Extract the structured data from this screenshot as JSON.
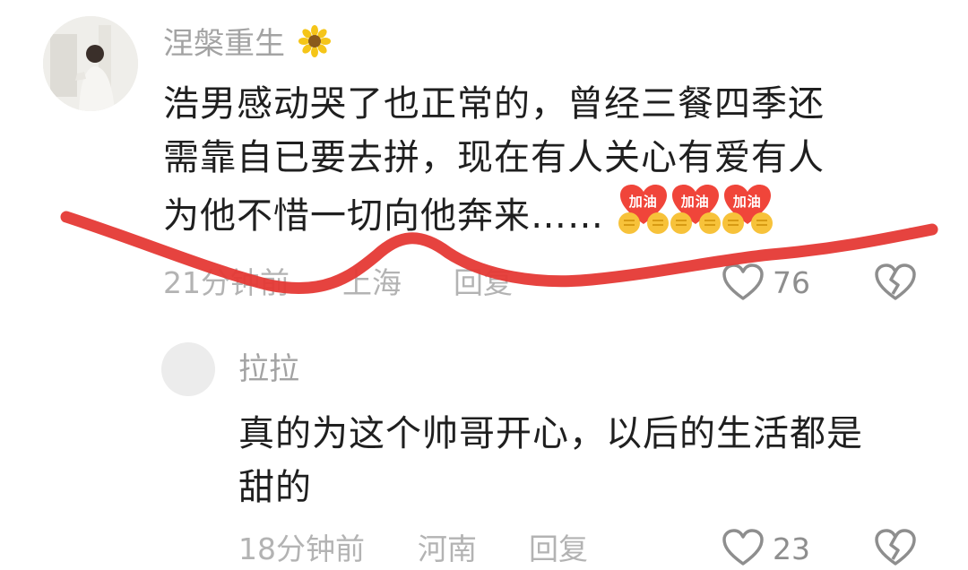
{
  "comment": {
    "username": "涅槃重生",
    "username_emoji_icon": "sunflower-icon",
    "text_lines": [
      "浩男感动哭了也正常的，曾经三餐四季还",
      "需靠自已要去拼，现在有人关心有爱有人",
      "为他不惜一切向他奔来……"
    ],
    "emoji_label": "加油",
    "time": "21分钟前",
    "location": "上海",
    "reply_label": "回复",
    "like_count": "76",
    "like_icon": "heart-outline-icon",
    "dislike_icon": "broken-heart-icon"
  },
  "reply": {
    "username": "拉拉",
    "text_lines": [
      "真的为这个帅哥开心，以后的生活都是",
      "甜的"
    ],
    "time": "18分钟前",
    "location": "河南",
    "reply_label": "回复",
    "like_count": "23"
  },
  "colors": {
    "annotation_stroke": "#e53935",
    "username": "#a3a3a3",
    "body_text": "#1f1f1f",
    "meta_text": "#b3b3b3",
    "emoji_heart": "#f0453a",
    "emoji_hands": "#f7c23a"
  }
}
